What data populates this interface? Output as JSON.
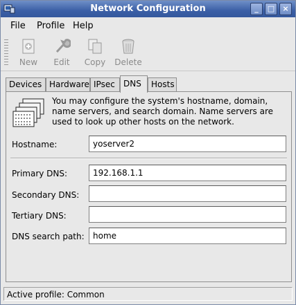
{
  "window": {
    "title": "Network Configuration",
    "minimize": "_",
    "maximize": "□",
    "close": "×"
  },
  "menu": {
    "file": "File",
    "profile": "Profile",
    "help": "Help"
  },
  "toolbar": {
    "new_label": "New",
    "edit_label": "Edit",
    "copy_label": "Copy",
    "delete_label": "Delete"
  },
  "tabs": [
    {
      "label": "Devices"
    },
    {
      "label": "Hardware"
    },
    {
      "label": "IPsec"
    },
    {
      "label": "DNS"
    },
    {
      "label": "Hosts"
    }
  ],
  "panel": {
    "description": "You may configure the system's hostname, domain, name servers, and search domain. Name servers are used to look up other hosts on the network.",
    "hostname": {
      "label": "Hostname:",
      "value": "yoserver2"
    },
    "primary_dns": {
      "label": "Primary DNS:",
      "value": "192.168.1.1"
    },
    "secondary_dns": {
      "label": "Secondary DNS:",
      "value": ""
    },
    "tertiary_dns": {
      "label": "Tertiary DNS:",
      "value": ""
    },
    "search_path": {
      "label": "DNS search path:",
      "value": "home"
    }
  },
  "status": {
    "text": "Active profile: Common"
  }
}
